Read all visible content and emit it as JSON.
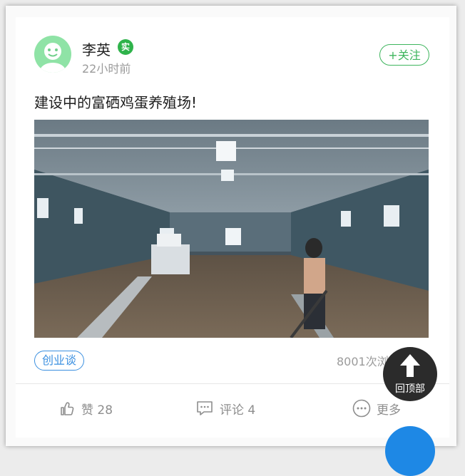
{
  "post": {
    "user": {
      "name": "李英",
      "verified_badge": "实",
      "time": "22小时前"
    },
    "follow_label": "关注",
    "text": "建设中的富硒鸡蛋养殖场!",
    "image_desc_icon": "photo",
    "tag": "创业谈",
    "views": "8001次浏"
  },
  "actions": {
    "like_label": "赞 28",
    "comment_label": "评论 4",
    "more_label": "更多"
  },
  "floating": {
    "back_to_top_label": "回顶部"
  },
  "colors": {
    "green": "#3eb55d",
    "blue": "#3a8fe0",
    "dark": "#2b2b2b"
  }
}
